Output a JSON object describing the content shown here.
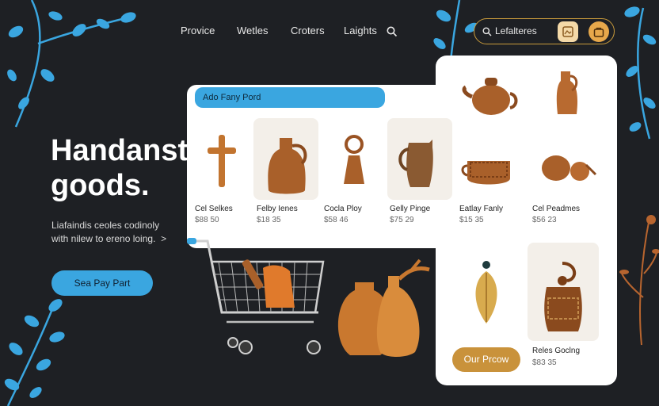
{
  "nav": {
    "items": [
      "Provice",
      "Wetles",
      "Croters",
      "Laights"
    ]
  },
  "search": {
    "placeholder": "Lefalteres"
  },
  "hero": {
    "title_line1": "Handansts",
    "title_line2": "goods.",
    "subtitle_line1": "Liafaindis ceoles codinoly",
    "subtitle_line2": "with nilew to ereno loing.",
    "subtitle_arrow": ">",
    "cta": "Sea Pay Part"
  },
  "panel": {
    "bar_label": "Ado Fany Pord",
    "products": [
      {
        "name": "Cel Selkes",
        "price": "$88 50"
      },
      {
        "name": "Felby Ienes",
        "price": "$18 35"
      },
      {
        "name": "Cocla Ploy",
        "price": "$58 46"
      },
      {
        "name": "Gelly Pinge",
        "price": "$75 29"
      },
      {
        "name": "Eatlay Fanly",
        "price": "$15 35"
      },
      {
        "name": "Cel Peadmes",
        "price": "$56 23"
      },
      {
        "name": "Reles Goclng",
        "price": "$83 35"
      }
    ],
    "cart_button": "Our Prcow"
  },
  "colors": {
    "accent_blue": "#3aa6e0",
    "accent_gold": "#c9923b",
    "background": "#1e2024",
    "terracotta": "#b8652f"
  }
}
